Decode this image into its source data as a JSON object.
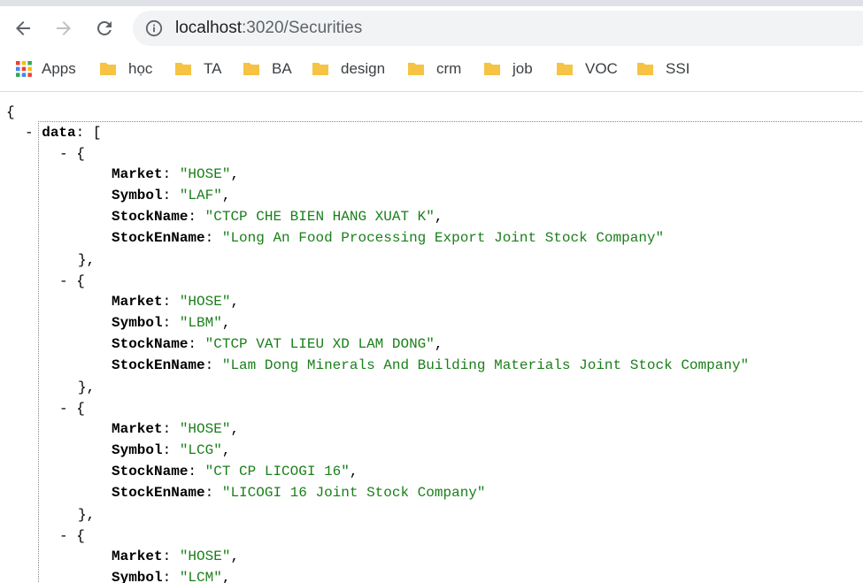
{
  "browser": {
    "url_host": "localhost",
    "url_rest": ":3020/Securities"
  },
  "bookmarks": [
    {
      "label": "Apps",
      "icon": "apps-grid-icon"
    },
    {
      "label": "học",
      "icon": "folder-icon"
    },
    {
      "label": "TA",
      "icon": "folder-icon"
    },
    {
      "label": "BA",
      "icon": "folder-icon"
    },
    {
      "label": "design",
      "icon": "folder-icon"
    },
    {
      "label": "crm",
      "icon": "folder-icon"
    },
    {
      "label": "job",
      "icon": "folder-icon"
    },
    {
      "label": "VOC",
      "icon": "folder-icon"
    },
    {
      "label": "SSI",
      "icon": "folder-icon"
    }
  ],
  "json": {
    "open_brace": "{",
    "collapse": "-",
    "data_key": "data",
    "colon": ":",
    "open_bracket": "[",
    "item_open": "- {",
    "item_close": "},",
    "comma": ",",
    "keys": {
      "market": "Market",
      "symbol": "Symbol",
      "stock_name": "StockName",
      "stock_en_name": "StockEnName"
    },
    "items": [
      {
        "market": "\"HOSE\"",
        "symbol": "\"LAF\"",
        "stock_name": "\"CTCP CHE BIEN HANG XUAT K\"",
        "stock_en_name": "\"Long An Food Processing Export Joint Stock Company\""
      },
      {
        "market": "\"HOSE\"",
        "symbol": "\"LBM\"",
        "stock_name": "\"CTCP VAT LIEU XD LAM DONG\"",
        "stock_en_name": "\"Lam Dong Minerals And Building Materials Joint Stock Company\""
      },
      {
        "market": "\"HOSE\"",
        "symbol": "\"LCG\"",
        "stock_name": "\"CT CP LICOGI 16\"",
        "stock_en_name": "\"LICOGI 16 Joint Stock Company\""
      },
      {
        "market": "\"HOSE\"",
        "symbol": "\"LCM\""
      }
    ]
  },
  "colors": {
    "key": "#000000",
    "string": "#1a7f1a",
    "folder": "#f6c344"
  }
}
